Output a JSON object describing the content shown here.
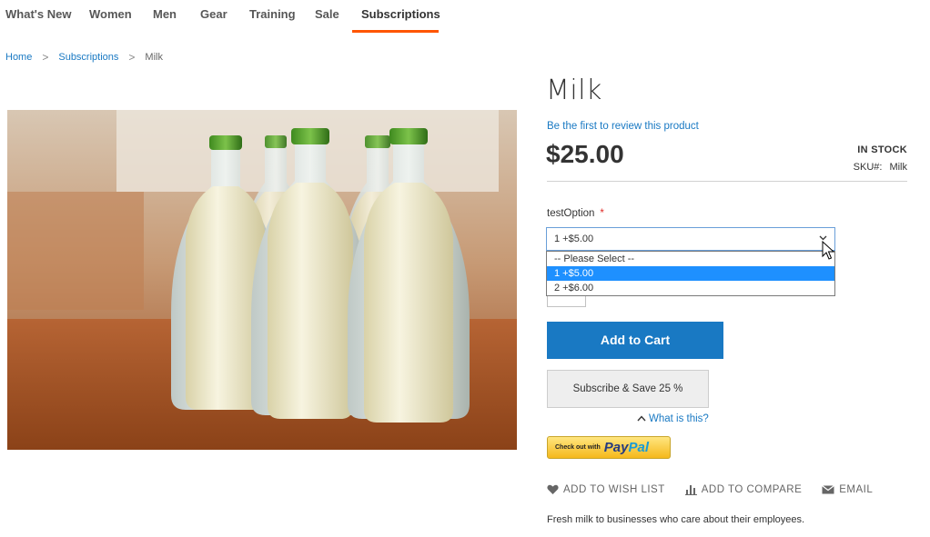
{
  "nav": {
    "items": [
      {
        "label": "What's New"
      },
      {
        "label": "Women"
      },
      {
        "label": "Men"
      },
      {
        "label": "Gear"
      },
      {
        "label": "Training"
      },
      {
        "label": "Sale"
      },
      {
        "label": "Subscriptions"
      }
    ],
    "active": "Subscriptions",
    "accent_color": "#ff5501"
  },
  "breadcrumb": {
    "items": [
      "Home",
      "Subscriptions",
      "Milk"
    ],
    "separator": ">"
  },
  "product": {
    "title": "Milk",
    "review_link": "Be the first to review this product",
    "price": "$25.00",
    "stock": "IN STOCK",
    "sku_label": "SKU#:",
    "sku_value": "Milk",
    "option": {
      "label": "testOption",
      "required_mark": "*",
      "selected": "1 +$5.00",
      "options": [
        "-- Please Select --",
        "1 +$5.00",
        "2 +$6.00"
      ],
      "highlighted_index": 1
    },
    "buttons": {
      "add_to_cart": "Add to Cart",
      "subscribe": "Subscribe & Save 25 %",
      "what_is_this": "What is this?",
      "paypal_small": "Check out with",
      "paypal_pay": "Pay",
      "paypal_pal": "Pal"
    },
    "actions": {
      "wishlist": "ADD TO WISH LIST",
      "compare": "ADD TO COMPARE",
      "email": "EMAIL"
    },
    "description": "Fresh milk to businesses who care about their employees."
  },
  "colors": {
    "primary_button": "#1979c3",
    "link": "#1979c3",
    "required": "#e02b27",
    "dropdown_highlight": "#1e90ff"
  }
}
